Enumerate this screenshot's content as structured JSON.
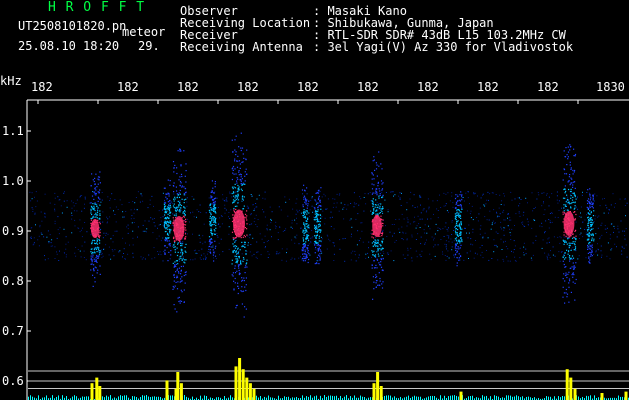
{
  "header": {
    "brand": "H R O F F T",
    "filename": "UT2508101820.pn",
    "datetime": "25.08.10 18:20",
    "count": "29.",
    "mode": "meteor",
    "info_labels": [
      "Observer",
      "Receiving Location",
      "Receiver",
      "Receiving Antenna"
    ],
    "info_values": [
      ": Masaki Kano",
      ": Shibukawa, Gunma, Japan",
      ": RTL-SDR SDR# 43dB L15 103.2MHz CW",
      ": 3el Yagi(V) Az 330 for Vladivostok"
    ]
  },
  "chart_data": {
    "type": "heatmap",
    "ylabel": "kHz",
    "x_ticks": [
      "182",
      "182",
      "182",
      "182",
      "182",
      "182",
      "182",
      "182",
      "182",
      "1830"
    ],
    "y_ticks": [
      "1.1",
      "1.0",
      "0.9",
      "0.8",
      "0.7",
      "0.6"
    ],
    "ylim": [
      0.56,
      1.16
    ],
    "colors": {
      "text": "#ffffff",
      "brand": "#00ff44",
      "bar": "#ffff00",
      "noise": "#00ffff",
      "hot": "#ff3070"
    },
    "noise_band_khz": [
      0.84,
      0.98
    ],
    "meteor_events": [
      {
        "minute": 1820.95,
        "center_khz": 0.905,
        "strength": 0.55
      },
      {
        "minute": 1822.15,
        "center_khz": 0.92,
        "strength": 0.3
      },
      {
        "minute": 1822.35,
        "center_khz": 0.905,
        "strength": 0.85
      },
      {
        "minute": 1822.9,
        "center_khz": 0.92,
        "strength": 0.3
      },
      {
        "minute": 1823.35,
        "center_khz": 0.915,
        "strength": 1.0
      },
      {
        "minute": 1824.45,
        "center_khz": 0.91,
        "strength": 0.3
      },
      {
        "minute": 1824.65,
        "center_khz": 0.91,
        "strength": 0.3
      },
      {
        "minute": 1825.65,
        "center_khz": 0.91,
        "strength": 0.7
      },
      {
        "minute": 1827.0,
        "center_khz": 0.91,
        "strength": 0.3
      },
      {
        "minute": 1828.85,
        "center_khz": 0.915,
        "strength": 0.85
      },
      {
        "minute": 1829.2,
        "center_khz": 0.91,
        "strength": 0.3
      }
    ],
    "yellow_bars": [
      {
        "minute": 1820.9,
        "level": 0.12
      },
      {
        "minute": 1820.98,
        "level": 0.16
      },
      {
        "minute": 1821.03,
        "level": 0.1
      },
      {
        "minute": 1822.15,
        "level": 0.14
      },
      {
        "minute": 1822.3,
        "level": 0.08
      },
      {
        "minute": 1822.33,
        "level": 0.2
      },
      {
        "minute": 1822.39,
        "level": 0.12
      },
      {
        "minute": 1823.3,
        "level": 0.24
      },
      {
        "minute": 1823.36,
        "level": 0.3
      },
      {
        "minute": 1823.42,
        "level": 0.22
      },
      {
        "minute": 1823.48,
        "level": 0.16
      },
      {
        "minute": 1823.54,
        "level": 0.12
      },
      {
        "minute": 1823.6,
        "level": 0.08
      },
      {
        "minute": 1825.6,
        "level": 0.12
      },
      {
        "minute": 1825.66,
        "level": 0.2
      },
      {
        "minute": 1825.72,
        "level": 0.1
      },
      {
        "minute": 1827.05,
        "level": 0.06
      },
      {
        "minute": 1828.82,
        "level": 0.22
      },
      {
        "minute": 1828.88,
        "level": 0.16
      },
      {
        "minute": 1828.95,
        "level": 0.08
      },
      {
        "minute": 1829.4,
        "level": 0.05
      },
      {
        "minute": 1829.8,
        "level": 0.06
      }
    ],
    "hlines_khz": [
      0.62,
      0.6,
      0.585
    ]
  }
}
